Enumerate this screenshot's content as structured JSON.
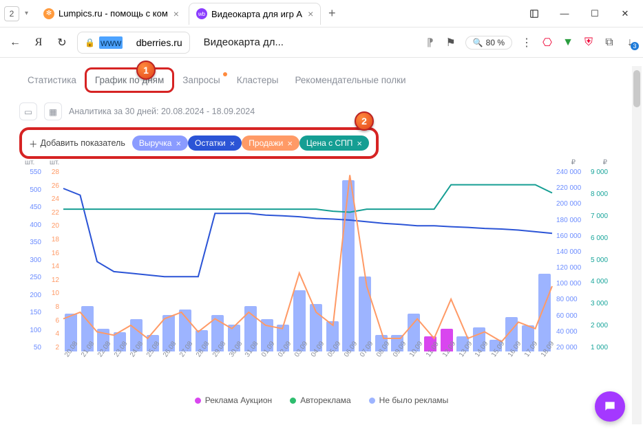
{
  "browser": {
    "tab_count": "2",
    "tabs": [
      {
        "favicon_bg": "#ff9a3d",
        "favicon_txt": "✻",
        "title": "Lumpics.ru - помощь с ком"
      },
      {
        "favicon_bg": "#8b3dff",
        "favicon_txt": "wb",
        "title": "Видеокарта для игр A"
      }
    ],
    "url_prefix": "www",
    "url_suffix": "dberries.ru",
    "page_title": "Видеокарта дл...",
    "zoom": "80 %"
  },
  "annotations": {
    "a1": "1",
    "a2": "2"
  },
  "tabs": {
    "items": [
      "Статистика",
      "График по дням",
      "Запросы",
      "Кластеры",
      "Рекомендательные полки"
    ],
    "highlighted_index": 1,
    "dot_index": 2
  },
  "toolbar": {
    "analytics_label": "Аналитика за 30 дней: 20.08.2024 - 18.09.2024"
  },
  "metrics": {
    "add_label": "Добавить показатель",
    "chips": [
      {
        "label": "Выручка",
        "bg": "#8a9bff"
      },
      {
        "label": "Остатки",
        "bg": "#2b54d6"
      },
      {
        "label": "Продажи",
        "bg": "#ff9a66"
      },
      {
        "label": "Цена с СПП",
        "bg": "#159e93"
      }
    ]
  },
  "legend": [
    {
      "label": "Реклама Аукцион",
      "color": "#d946ef"
    },
    {
      "label": "Автореклама",
      "color": "#2dbd6e"
    },
    {
      "label": "Не было рекламы",
      "color": "#9db4ff"
    }
  ],
  "chart_data": {
    "type": "bar+line",
    "categories": [
      "20.08",
      "21.08",
      "22.08",
      "23.08",
      "24.08",
      "25.08",
      "26.08",
      "27.08",
      "28.08",
      "29.08",
      "30.08",
      "31.08",
      "01.09",
      "02.09",
      "03.09",
      "04.09",
      "05.09",
      "06.09",
      "07.09",
      "08.09",
      "09.09",
      "10.09",
      "11.09",
      "12.09",
      "13.09",
      "14.09",
      "15.09",
      "16.09",
      "17.09",
      "18.09"
    ],
    "axes": {
      "y_left_primary": {
        "unit": "шт.",
        "ticks": [
          50,
          100,
          150,
          200,
          250,
          300,
          350,
          400,
          450,
          500,
          550
        ],
        "color": "#6b8cff"
      },
      "y_left_secondary": {
        "unit": "шт.",
        "ticks": [
          2,
          4,
          6,
          8,
          10,
          12,
          14,
          16,
          18,
          20,
          22,
          24,
          26,
          28
        ],
        "color": "#ff9a66"
      },
      "y_right_primary": {
        "unit": "₽",
        "ticks": [
          20000,
          40000,
          60000,
          80000,
          100000,
          120000,
          140000,
          160000,
          180000,
          200000,
          220000,
          240000
        ],
        "color": "#6b8cff"
      },
      "y_right_secondary": {
        "unit": "₽",
        "ticks": [
          1000,
          2000,
          3000,
          4000,
          5000,
          6000,
          7000,
          8000,
          9000
        ],
        "color": "#17a49a"
      }
    },
    "bars_series": {
      "name": "Выручка",
      "axis": "y_right_primary",
      "values": [
        50000,
        60000,
        30000,
        25000,
        42000,
        22000,
        48000,
        55000,
        28000,
        48000,
        35000,
        60000,
        42000,
        35000,
        80000,
        62000,
        40000,
        225000,
        98000,
        22000,
        22000,
        50000,
        20000,
        30000,
        20000,
        32000,
        15000,
        45000,
        34000,
        102000
      ],
      "ad_type": [
        "none",
        "none",
        "none",
        "none",
        "none",
        "none",
        "none",
        "none",
        "none",
        "none",
        "none",
        "none",
        "none",
        "none",
        "none",
        "none",
        "none",
        "none",
        "none",
        "none",
        "none",
        "none",
        "auction",
        "auction",
        "none",
        "none",
        "none",
        "none",
        "none",
        "none"
      ]
    },
    "lines": [
      {
        "name": "Остатки",
        "axis": "y_left_primary",
        "color": "#2b54d6",
        "values": [
          490,
          470,
          270,
          240,
          235,
          230,
          225,
          225,
          225,
          415,
          415,
          415,
          410,
          408,
          405,
          400,
          398,
          395,
          390,
          385,
          382,
          378,
          378,
          375,
          373,
          370,
          368,
          365,
          360,
          355
        ]
      },
      {
        "name": "Цена с СПП",
        "axis": "y_right_secondary",
        "color": "#159e93",
        "values": [
          7000,
          7000,
          7000,
          7000,
          7000,
          7000,
          7000,
          7000,
          7000,
          7000,
          7000,
          7000,
          7000,
          7000,
          7000,
          7000,
          6900,
          6850,
          7000,
          7000,
          7000,
          7000,
          7000,
          8200,
          8200,
          8200,
          8200,
          8200,
          8200,
          7800
        ]
      },
      {
        "name": "Продажи",
        "axis": "y_left_secondary",
        "color": "#ff9a66",
        "values": [
          5,
          6,
          3,
          2.5,
          4,
          2,
          5,
          6,
          3,
          5,
          3.5,
          6,
          4,
          3.5,
          12,
          6,
          4,
          27,
          10,
          2,
          2,
          5,
          2,
          8,
          2,
          3,
          1.5,
          4.5,
          3.5,
          10
        ]
      }
    ]
  }
}
